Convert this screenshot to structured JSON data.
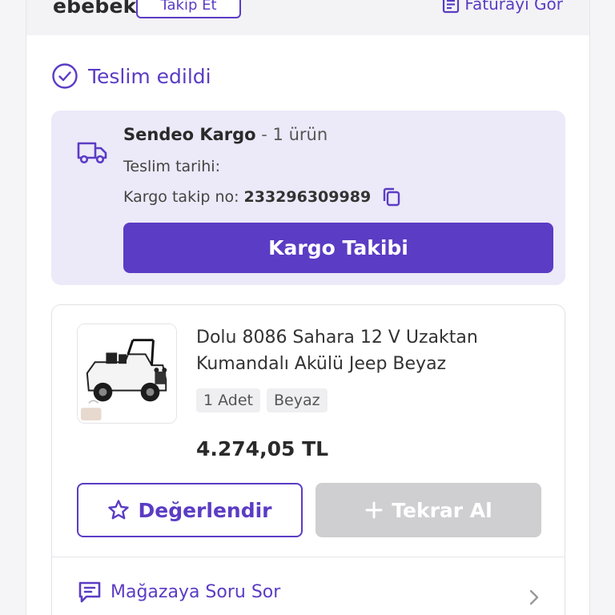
{
  "header": {
    "store_name": "ebebek",
    "follow_label": "Takip Et",
    "invoice_label": "Faturayı Gör"
  },
  "status": {
    "label": "Teslim edildi"
  },
  "shipment": {
    "carrier": "Sendeo Kargo",
    "separator": " - ",
    "item_count": "1 ürün",
    "delivery_date_label": "Teslim tarihi:",
    "tracking_label": "Kargo takip no:",
    "tracking_number": "233296309989",
    "track_button_label": "Kargo Takibi"
  },
  "product": {
    "title": "Dolu 8086 Sahara 12 V Uzaktan Kumandalı Akülü Jeep Beyaz",
    "quantity": "1 Adet",
    "color": "Beyaz",
    "price": "4.274,05 TL",
    "rate_button_label": "Değerlendir",
    "rebuy_button_label": "Tekrar Al",
    "ask_store_label": "Mağazaya Soru Sor"
  },
  "icons": {
    "invoice": "document-icon",
    "status": "check-circle-icon",
    "truck": "truck-icon",
    "copy": "copy-icon",
    "star": "star-icon",
    "plus": "plus-icon",
    "message": "message-icon",
    "chevron": "chevron-right-icon"
  },
  "colors": {
    "accent": "#5b3cc4",
    "card_bg": "#ece9f8",
    "disabled": "#cfcfd1"
  }
}
